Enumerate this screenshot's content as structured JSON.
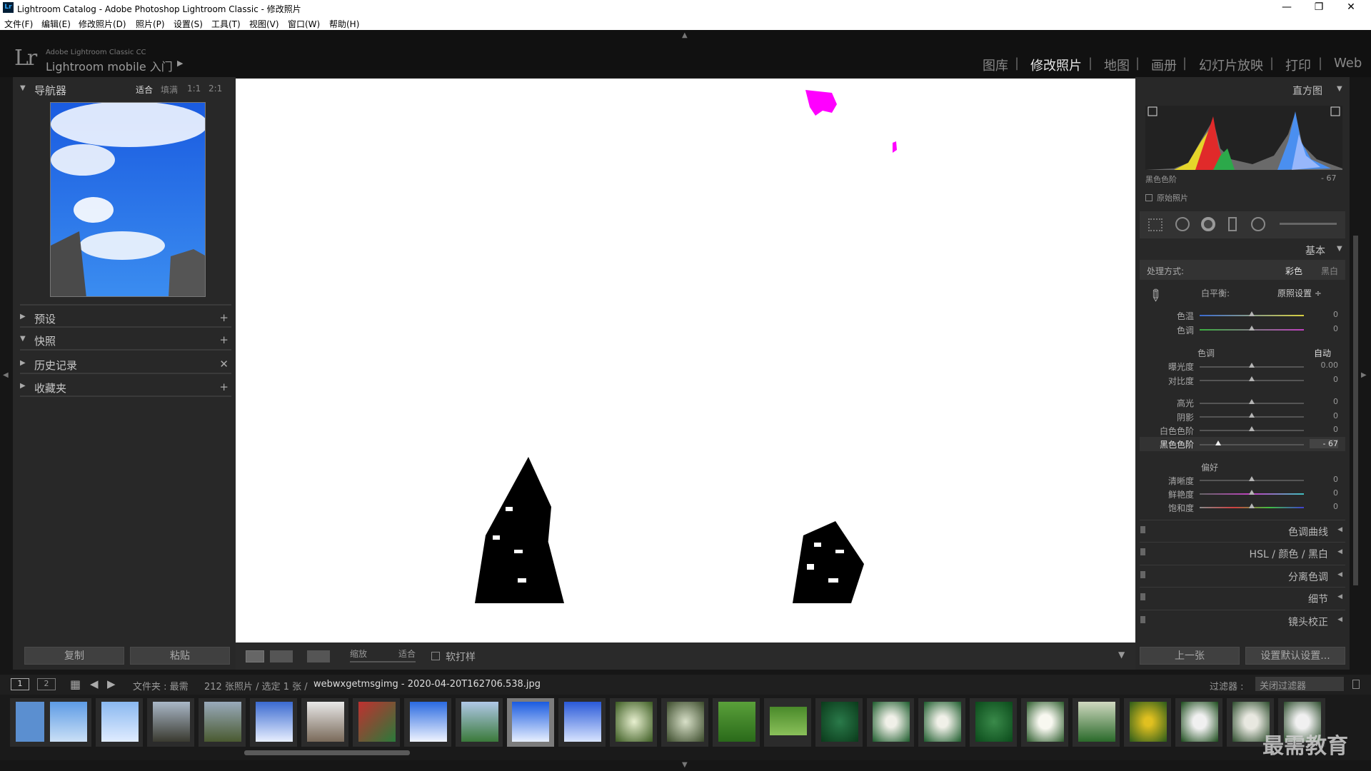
{
  "window": {
    "title": "Lightroom Catalog - Adobe Photoshop Lightroom Classic - 修改照片",
    "minimize": "—",
    "maximize": "❐",
    "close": "✕"
  },
  "menu": [
    "文件(F)",
    "编辑(E)",
    "修改照片(D)",
    "照片(P)",
    "设置(S)",
    "工具(T)",
    "视图(V)",
    "窗口(W)",
    "帮助(H)"
  ],
  "identity": {
    "logo": "Lr",
    "small": "Adobe Lightroom Classic CC",
    "mobile": "Lightroom mobile 入门",
    "arrow": "▶"
  },
  "modules": [
    "图库",
    "修改照片",
    "地图",
    "画册",
    "幻灯片放映",
    "打印",
    "Web"
  ],
  "module_sep": "|",
  "left": {
    "navigator": "导航器",
    "nav_opts": [
      "适合",
      "填满",
      "1:1",
      "2:1"
    ],
    "sections": [
      {
        "label": "预设",
        "action": "+"
      },
      {
        "label": "快照",
        "action": "+"
      },
      {
        "label": "历史记录",
        "action": "✕"
      },
      {
        "label": "收藏夹",
        "action": "+"
      }
    ],
    "copy": "复制",
    "paste": "粘贴"
  },
  "toolbar": {
    "zoom": "缩放",
    "fit": "适合",
    "soft_proof": "软打样"
  },
  "right": {
    "histogram": "直方图",
    "hist_readout_label": "黑色色阶",
    "hist_readout_value": "- 67",
    "original": "原始照片",
    "basic": "基本",
    "treatment_label": "处理方式:",
    "color": "彩色",
    "bw": "黑白",
    "wb_label": "白平衡:",
    "wb_value": "原照设置 ÷",
    "temp": "色温",
    "tint": "色调",
    "tone": "色调",
    "auto": "自动",
    "exposure": "曝光度",
    "exposure_val": "0.00",
    "contrast": "对比度",
    "highlights": "高光",
    "shadows": "阴影",
    "whites": "白色色阶",
    "blacks": "黑色色阶",
    "blacks_val": "- 67",
    "presence": "偏好",
    "clarity": "清晰度",
    "vibrance": "鲜艳度",
    "saturation": "饱和度",
    "zero": "0",
    "sections": [
      "色调曲线",
      "HSL / 颜色 / 黑白",
      "分离色调",
      "细节",
      "镜头校正"
    ],
    "prev": "上一张",
    "reset": "设置默认设置..."
  },
  "filmbar": {
    "page1": "1",
    "page2": "2",
    "source": "文件夹 : 最需",
    "count": "212 张照片 / 选定 1 张 /",
    "file": "webwxgetmsgimg - 2020-04-20T162706.538.jpg",
    "filter_label": "过滤器 :",
    "filter_value": "关闭过滤器"
  },
  "watermark": "最需教育",
  "colors": {
    "accent": "#ff00ff",
    "panel": "#282828",
    "canvas": "#ffffff"
  }
}
